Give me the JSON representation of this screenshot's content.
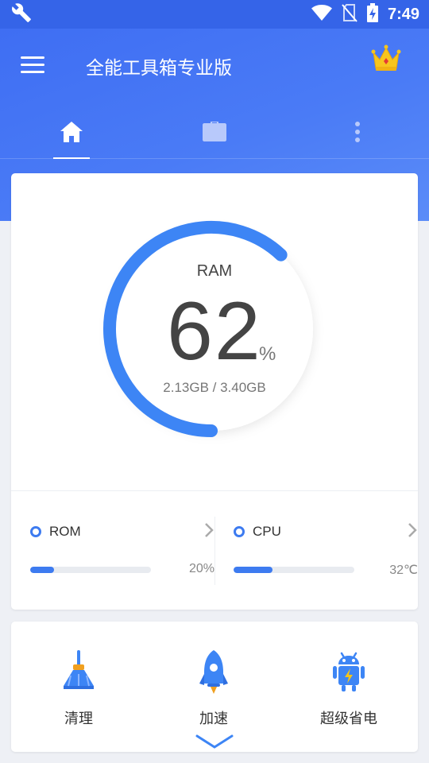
{
  "status_bar": {
    "time": "7:49",
    "icons": [
      "wrench-icon",
      "wifi-icon",
      "no-sim-icon",
      "battery-charging-icon"
    ]
  },
  "app_bar": {
    "title": "全能工具箱专业版",
    "menu_icon": "menu-icon",
    "premium_icon": "crown-icon"
  },
  "tabs": [
    {
      "icon": "home-icon",
      "selected": true
    },
    {
      "icon": "briefcase-icon",
      "selected": false
    },
    {
      "icon": "more-vertical-icon",
      "selected": false
    }
  ],
  "ram": {
    "label": "RAM",
    "percent": 62,
    "percent_text": "62",
    "unit": "%",
    "detail": "2.13GB / 3.40GB"
  },
  "stats": {
    "rom": {
      "name": "ROM",
      "value_text": "20%",
      "level": 0.2
    },
    "cpu": {
      "name": "CPU",
      "value_text": "32℃",
      "level": 0.32
    }
  },
  "actions": [
    {
      "label": "清理",
      "icon": "broom-icon"
    },
    {
      "label": "加速",
      "icon": "rocket-icon"
    },
    {
      "label": "超级省电",
      "icon": "battery-saver-icon"
    }
  ],
  "expand_icon": "chevron-down-icon",
  "colors": {
    "primary": "#3d6cf2",
    "accent": "#3d7bf0",
    "gold": "#f5c518"
  }
}
